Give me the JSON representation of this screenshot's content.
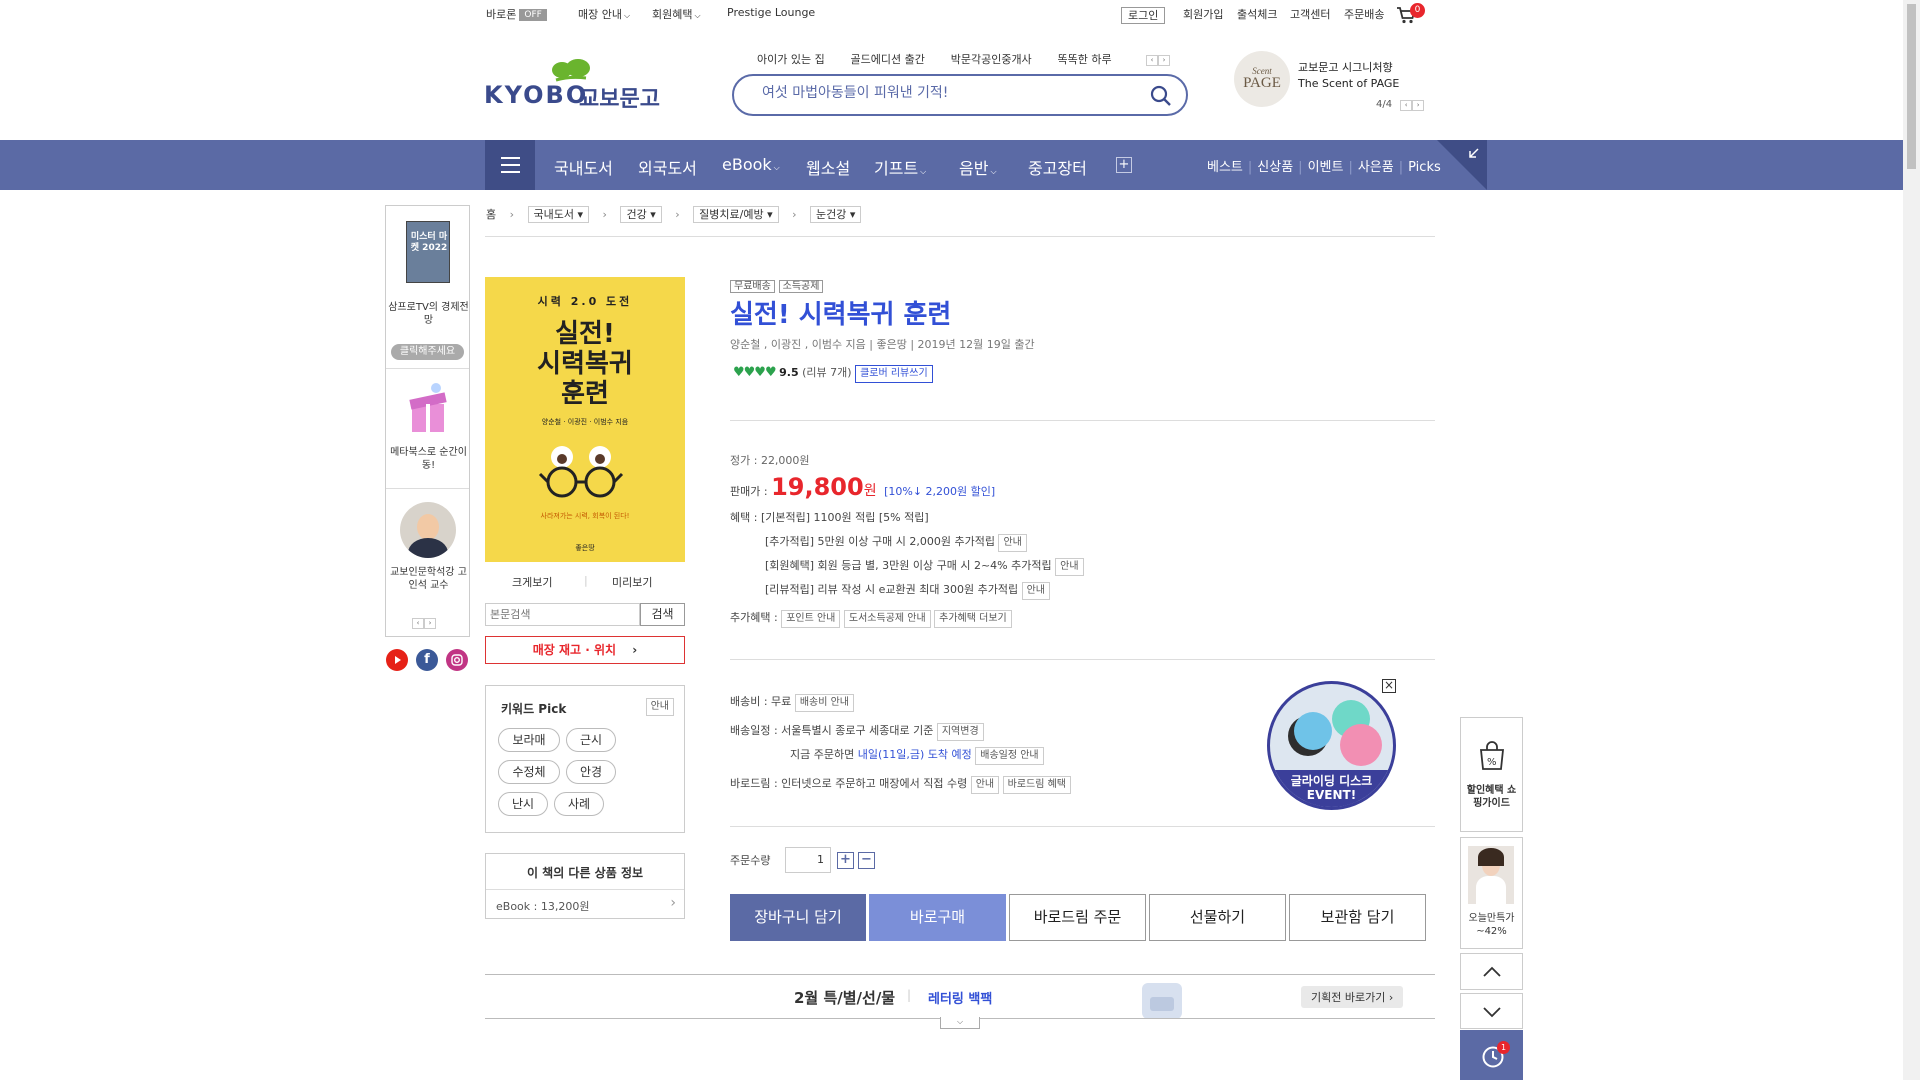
{
  "util": {
    "barodream": "바로론",
    "barodream_badge": "OFF",
    "store": "매장 안내",
    "membership": "회원혜택",
    "prestige": "Prestige Lounge",
    "login": "로그인",
    "join": "회원가입",
    "attendance": "출석체크",
    "support": "고객센터",
    "order": "주문배송",
    "cart_count": "0"
  },
  "logo": {
    "text_en": "KYOBO",
    "text_ko": "교보문고"
  },
  "topic_links": [
    "아이가 있는 집",
    "골드에디션 출간",
    "박문각공인중개사",
    "똑똑한 하루"
  ],
  "search": {
    "placeholder": "여섯 마법아동들이 피워낸 기적!"
  },
  "promo": {
    "logo_line1": "Scent",
    "logo_line2": "PAGE",
    "line1": "교보문고 시그니처향",
    "line2": "The Scent of PAGE",
    "pager": "4/4"
  },
  "gnb": {
    "items": [
      "국내도서",
      "외국도서",
      "eBook",
      "웹소설",
      "기프트",
      "음반",
      "중고장터"
    ],
    "right": [
      "베스트",
      "신상품",
      "이벤트",
      "사은품",
      "Picks"
    ]
  },
  "breadcrumb": {
    "home": "홈",
    "items": [
      "국내도서",
      "건강",
      "질병치료/예방",
      "눈건강"
    ]
  },
  "left_quick": {
    "banner1_img": "미스터 마켓 2022",
    "banner1": "삼프로TV의 경제전망",
    "banner1_btn": "클릭해주세요",
    "banner2": "메타북스로 순간이동!",
    "banner3": "교보인문학석강 고인석 교수"
  },
  "cover": {
    "top": "시력 2.0 도전",
    "title1": "실전!",
    "title2": "시력복귀",
    "title3": "훈련",
    "author": "양순철 · 이광진 · 이범수 지음",
    "bottom": "사라져가는 시력, 회복이 된다!",
    "publisher": "좋은땅"
  },
  "cover_actions": {
    "zoom": "크게보기",
    "preview": "미리보기"
  },
  "inner_search": {
    "placeholder": "본문검색",
    "button": "검색"
  },
  "store_stock": "매장 재고 · 위치",
  "keyword": {
    "title": "키워드 Pick",
    "info": "안내",
    "items": [
      "보라매",
      "근시",
      "수정체",
      "안경",
      "난시",
      "사례"
    ]
  },
  "other_info": {
    "title": "이 책의 다른 상품 정보",
    "ebook": "eBook : 13,200원"
  },
  "book": {
    "tags": [
      "무료배송",
      "소득공제"
    ],
    "title": "실전! 시력복귀 훈련",
    "meta": "양순철 , 이광진 , 이범수 지음  |  좋은땅  |  2019년 12월 19일 출간",
    "rating": "9.5",
    "review_count": "(리뷰 7개)",
    "review_btn": "클로버 리뷰쓰기",
    "list_price": "정가 : 22,000원",
    "sale_label": "판매가 :",
    "sale_price": "19,800",
    "sale_unit": "원",
    "discount": "[10%↓ 2,200원 할인]",
    "benefit_label": "혜택 :",
    "benefit1": "[기본적립] 1100원 적립 [5% 적립]",
    "benefit2": "[추가적립] 5만원 이상 구매 시 2,000원 추가적립",
    "benefit3": "[회원혜택] 회원 등급 별, 3만원 이상 구매 시 2~4% 추가적립",
    "benefit4": "[리뷰적립] 리뷰 작성 시 e교환권 최대 300원 추가적립",
    "info_btn": "안내",
    "extra_label": "추가혜택 :",
    "extra_btns": [
      "포인트 안내",
      "도서소득공제 안내",
      "추가혜택 더보기"
    ]
  },
  "shipping": {
    "fee": "배송비 : 무료",
    "fee_btn": "배송비 안내",
    "schedule": "배송일정 : 서울특별시 종로구 세종대로 기준",
    "region_btn": "지역변경",
    "order_now": "지금 주문하면",
    "arrival": "내일(11일,금) 도착 예정",
    "schedule_btn": "배송일정 안내",
    "barodream": "바로드림 : 인터넷으로 주문하고 매장에서 직접 수령",
    "barodream_btn1": "안내",
    "barodream_btn2": "바로드림 혜택"
  },
  "event": {
    "line1": "글라이딩 디스크",
    "line2": "EVENT!"
  },
  "quantity": {
    "label": "주문수량",
    "value": "1"
  },
  "buy_buttons": [
    "장바구니 담기",
    "바로구매",
    "바로드림 주문",
    "선물하기",
    "보관함 담기"
  ],
  "bottom_banner": {
    "title": "2월 특/별/선/물",
    "sub": "레터링 백팩",
    "btn": "기획전 바로가기"
  },
  "right_quick": {
    "guide": "할인혜택 쇼핑가이드",
    "today": "오늘만특가 ~42%",
    "recent_count": "1"
  },
  "colors": {
    "nav": "#5b6aa5",
    "accent": "#3250d6",
    "price": "#e8262c"
  }
}
